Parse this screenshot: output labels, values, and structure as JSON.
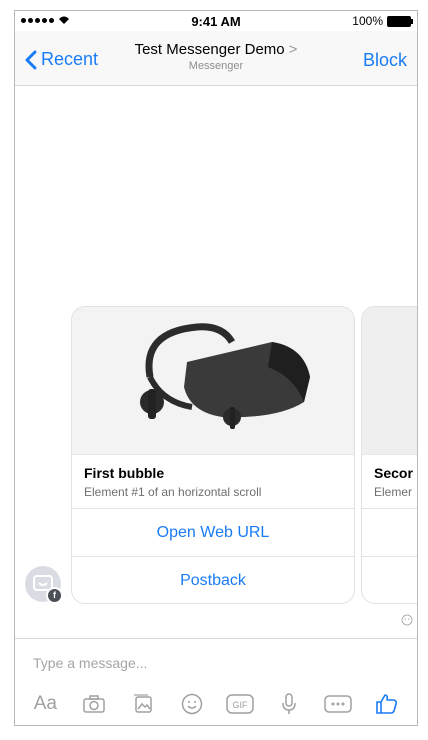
{
  "status_bar": {
    "time": "9:41 AM",
    "battery": "100%"
  },
  "nav": {
    "back_label": "Recent",
    "title": "Test Messenger Demo",
    "title_chevron": ">",
    "subtitle": "Messenger",
    "block_label": "Block"
  },
  "cards": [
    {
      "title": "First bubble",
      "subtitle": "Element #1 of an horizontal scroll",
      "buttons": [
        "Open Web URL",
        "Postback"
      ]
    },
    {
      "title": "Secor",
      "subtitle": "Elemer"
    }
  ],
  "composer": {
    "placeholder": "Type a message...",
    "tools": [
      "text-icon",
      "camera-icon",
      "gallery-icon",
      "emoji-icon",
      "gif-icon",
      "microphone-icon",
      "more-icon",
      "thumbs-up-icon"
    ],
    "aa_label": "Aa",
    "gif_label": "GIF"
  },
  "colors": {
    "accent": "#1a7cf4",
    "muted": "#a0a0a0"
  }
}
